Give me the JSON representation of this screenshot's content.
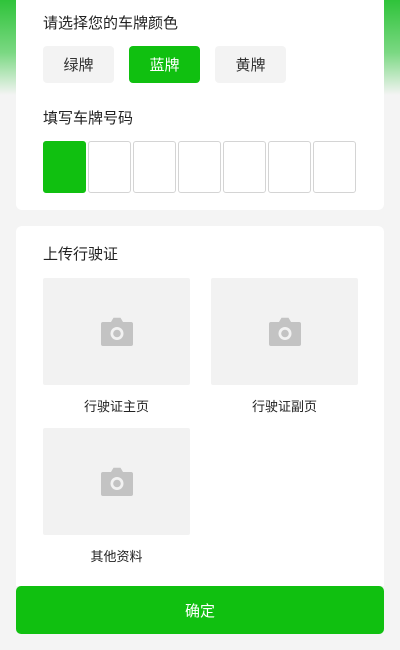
{
  "plate_color": {
    "label": "请选择您的车牌颜色",
    "options": [
      {
        "label": "绿牌",
        "selected": false
      },
      {
        "label": "蓝牌",
        "selected": true
      },
      {
        "label": "黄牌",
        "selected": false
      }
    ],
    "accent_color": "#10c010"
  },
  "plate_number": {
    "label": "填写车牌号码",
    "boxes": [
      "",
      "",
      "",
      "",
      "",
      "",
      "",
      ""
    ],
    "active_index": 0
  },
  "license_upload": {
    "label": "上传行驶证",
    "tiles": [
      {
        "caption": "行驶证主页",
        "icon": "camera-icon"
      },
      {
        "caption": "行驶证副页",
        "icon": "camera-icon"
      },
      {
        "caption": "其他资料",
        "icon": "camera-icon"
      }
    ]
  },
  "footer": {
    "confirm_label": "确定"
  }
}
